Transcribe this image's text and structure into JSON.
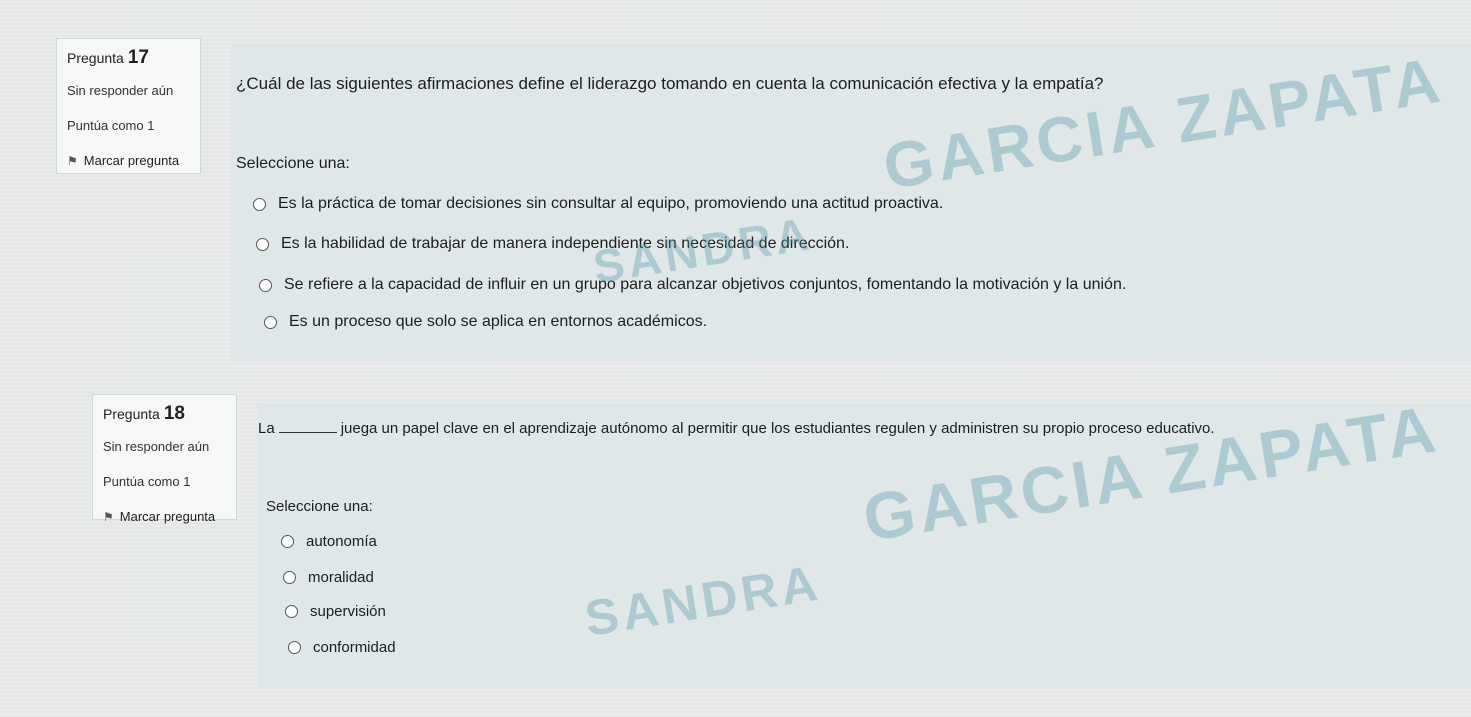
{
  "q17": {
    "label": "Pregunta",
    "number": "17",
    "status": "Sin responder aún",
    "score": "Puntúa como 1",
    "flag_label": "Marcar pregunta",
    "question": "¿Cuál de las siguientes afirmaciones define el liderazgo tomando en cuenta la comunicación efectiva y la empatía?",
    "prompt": "Seleccione una:",
    "options": [
      "Es la práctica de tomar decisiones sin consultar al equipo, promoviendo una actitud proactiva.",
      "Es la habilidad de trabajar de manera independiente sin necesidad de dirección.",
      "Se refiere a la capacidad de influir en un grupo para alcanzar objetivos conjuntos, fomentando la motivación y la unión.",
      "Es un proceso que solo se aplica en entornos académicos."
    ]
  },
  "q18": {
    "label": "Pregunta",
    "number": "18",
    "status": "Sin responder aún",
    "score": "Puntúa como 1",
    "flag_label": "Marcar pregunta",
    "question_start": "La",
    "question_end": "juega un papel clave en el aprendizaje autónomo al permitir que los estudiantes regulen y administren su propio proceso educativo.",
    "prompt": "Seleccione una:",
    "options": [
      "autonomía",
      "moralidad",
      "supervisión",
      "conformidad"
    ]
  },
  "watermark": {
    "line1": "SANDRA",
    "line2": "GARCIA ZAPATA",
    "color": "#5096aa"
  }
}
